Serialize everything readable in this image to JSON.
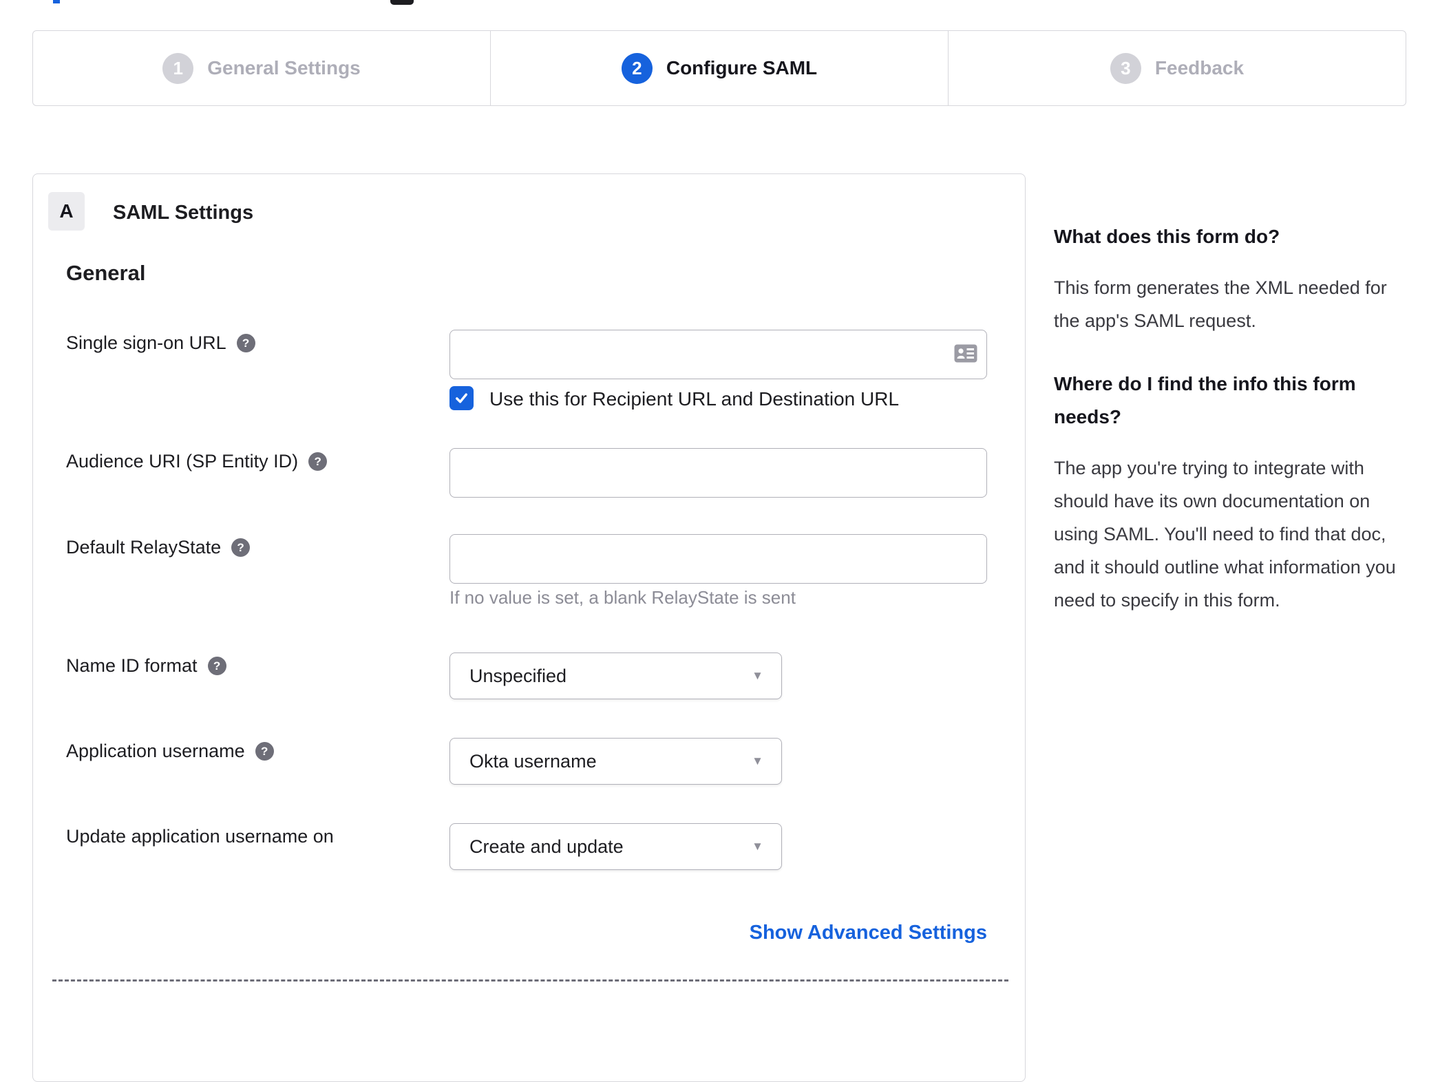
{
  "stepper": {
    "steps": [
      {
        "number": "1",
        "label": "General Settings",
        "state": "inactive"
      },
      {
        "number": "2",
        "label": "Configure SAML",
        "state": "active"
      },
      {
        "number": "3",
        "label": "Feedback",
        "state": "inactive"
      }
    ]
  },
  "panel": {
    "section_badge": "A",
    "section_title": "SAML Settings",
    "group_heading": "General",
    "fields": {
      "sso_url": {
        "label": "Single sign-on URL",
        "value": "",
        "checkbox_label": "Use this for Recipient URL and Destination URL",
        "checked": true
      },
      "audience_uri": {
        "label": "Audience URI (SP Entity ID)",
        "value": ""
      },
      "default_relaystate": {
        "label": "Default RelayState",
        "value": "",
        "hint": "If no value is set, a blank RelayState is sent"
      },
      "name_id_format": {
        "label": "Name ID format",
        "value": "Unspecified"
      },
      "application_username": {
        "label": "Application username",
        "value": "Okta username"
      },
      "update_app_username_on": {
        "label": "Update application username on",
        "value": "Create and update"
      }
    },
    "advanced_link": "Show Advanced Settings"
  },
  "sidebar": {
    "blocks": [
      {
        "heading": "What does this form do?",
        "body": "This form generates the XML needed for the app's SAML request."
      },
      {
        "heading": "Where do I find the info this form needs?",
        "body": "The app you're trying to integrate with should have its own documentation on using SAML. You'll need to find that doc, and it should outline what information you need to specify in this form."
      }
    ]
  },
  "icons": {
    "help": "?",
    "dropdown_arrow": "▼"
  },
  "colors": {
    "accent_blue": "#1662dd",
    "inactive_gray": "#d2d2d8",
    "border_gray": "#d7d7dc",
    "hint_gray": "#8c8c96"
  }
}
